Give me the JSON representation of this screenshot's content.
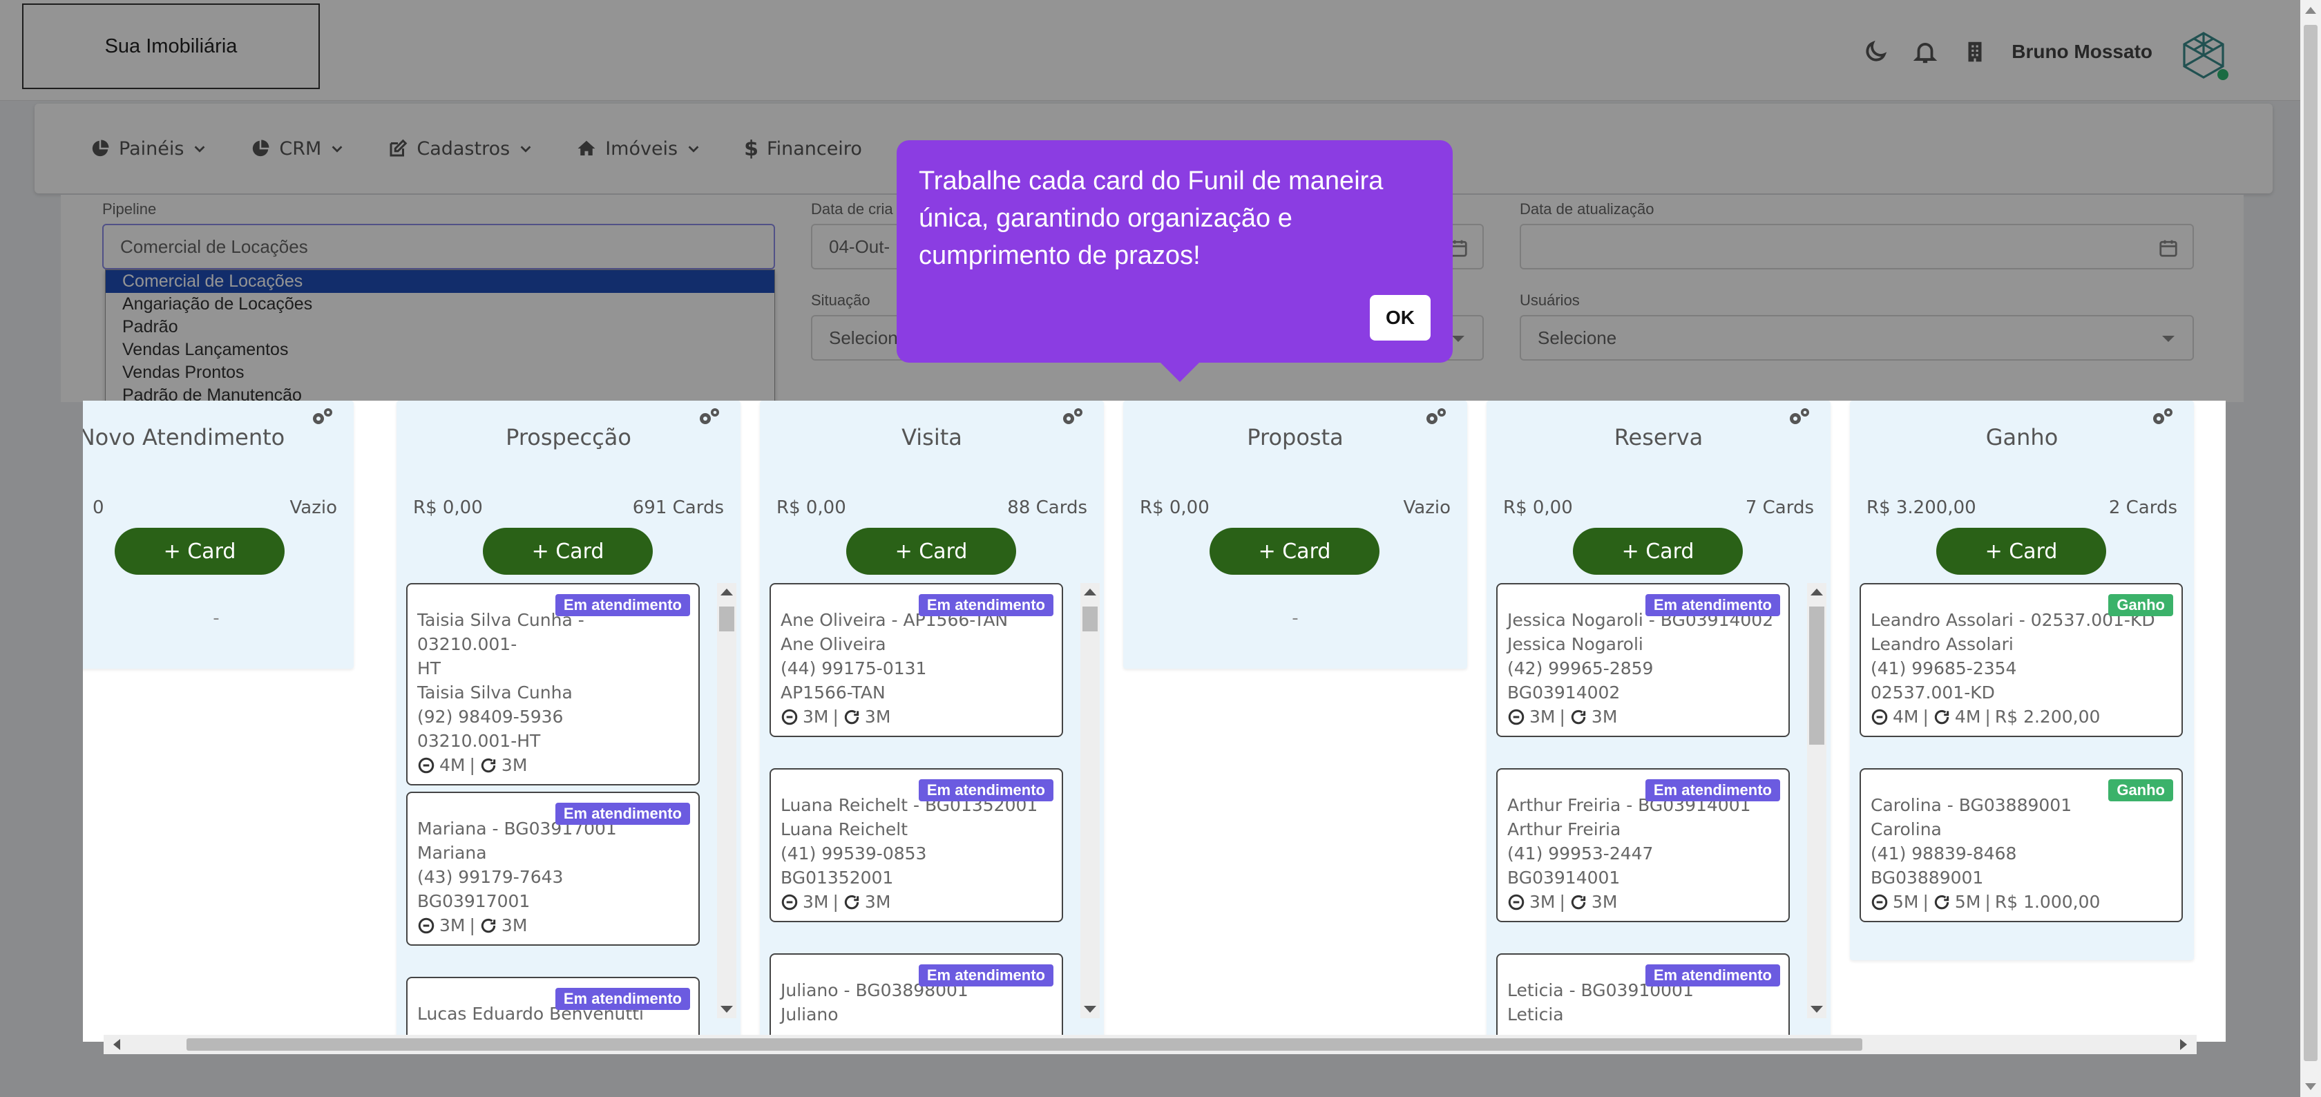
{
  "app": {
    "logo_text": "Sua Imobiliária",
    "user_name": "Bruno Mossato"
  },
  "icons": {
    "theme": "moon-icon",
    "notifications": "bell-icon",
    "company": "building-icon",
    "settings": "gears-icon"
  },
  "nav": {
    "items": [
      {
        "label": "Painéis",
        "icon": "pie-chart-icon",
        "dropdown": true
      },
      {
        "label": "CRM",
        "icon": "pie-chart-icon",
        "dropdown": true
      },
      {
        "label": "Cadastros",
        "icon": "edit-icon",
        "dropdown": true
      },
      {
        "label": "Imóveis",
        "icon": "home-icon",
        "dropdown": true
      },
      {
        "label": "Financeiro",
        "icon": "dollar-icon",
        "dropdown": false
      }
    ]
  },
  "filters": {
    "pipeline_label": "Pipeline",
    "pipeline_value": "Comercial de Locações",
    "pipeline_options": [
      "Comercial de Locações",
      "Angariação de Locações",
      "Padrão",
      "Vendas Lançamentos",
      "Vendas Prontos",
      "Padrão de Manutenção"
    ],
    "created_label": "Data de cria",
    "created_value": "04-Out-",
    "updated_label": "Data de atualização",
    "updated_value": "",
    "situation_label": "Situação",
    "situation_placeholder": "Selecione",
    "users_label": "Usuários",
    "users_placeholder": "Selecione"
  },
  "tooltip": {
    "text": "Trabalhe cada card do Funil de maneira única, garantindo organização e cumprimento de prazos!",
    "ok_label": "OK"
  },
  "board": {
    "add_label": "+ Card",
    "columns": [
      {
        "title": "Novo Atendimento",
        "money": "0",
        "count": "Vazio",
        "empty": "-",
        "cards": []
      },
      {
        "title": "Prospecção",
        "money": "R$ 0,00",
        "count": "691 Cards",
        "cards": [
          {
            "badge": "Em atendimento",
            "badge_type": "atd",
            "lines": [
              "Taisia Silva Cunha - 03210.001-",
              "HT",
              "Taisia Silva Cunha",
              "(92) 98409-5936",
              "03210.001-HT"
            ],
            "meta_a": "4M",
            "meta_b": "3M",
            "extra": ""
          },
          {
            "badge": "Em atendimento",
            "badge_type": "atd",
            "lines": [
              "Mariana - BG03917001",
              "Mariana",
              "(43) 99179-7643",
              "BG03917001"
            ],
            "meta_a": "3M",
            "meta_b": "3M",
            "extra": ""
          },
          {
            "badge": "Em atendimento",
            "badge_type": "atd",
            "lines": [
              "Lucas Eduardo Benvenutti"
            ],
            "meta_a": "",
            "meta_b": "",
            "extra": ""
          }
        ]
      },
      {
        "title": "Visita",
        "money": "R$ 0,00",
        "count": "88 Cards",
        "cards": [
          {
            "badge": "Em atendimento",
            "badge_type": "atd",
            "lines": [
              "Ane Oliveira - AP1566-TAN",
              "Ane Oliveira",
              "(44) 99175-0131",
              "AP1566-TAN"
            ],
            "meta_a": "3M",
            "meta_b": "3M",
            "extra": ""
          },
          {
            "badge": "Em atendimento",
            "badge_type": "atd",
            "lines": [
              "Luana Reichelt - BG01352001",
              "Luana Reichelt",
              "(41) 99539-0853",
              "BG01352001"
            ],
            "meta_a": "3M",
            "meta_b": "3M",
            "extra": ""
          },
          {
            "badge": "Em atendimento",
            "badge_type": "atd",
            "lines": [
              "Juliano - BG03898001",
              "Juliano"
            ],
            "meta_a": "",
            "meta_b": "",
            "extra": ""
          }
        ]
      },
      {
        "title": "Proposta",
        "money": "R$ 0,00",
        "count": "Vazio",
        "empty": "-",
        "cards": []
      },
      {
        "title": "Reserva",
        "money": "R$ 0,00",
        "count": "7 Cards",
        "cards": [
          {
            "badge": "Em atendimento",
            "badge_type": "atd",
            "lines": [
              "Jessica Nogaroli - BG03914002",
              "Jessica Nogaroli",
              "(42) 99965-2859",
              "BG03914002"
            ],
            "meta_a": "3M",
            "meta_b": "3M",
            "extra": ""
          },
          {
            "badge": "Em atendimento",
            "badge_type": "atd",
            "lines": [
              "Arthur Freiria - BG03914001",
              "Arthur Freiria",
              "(41) 99953-2447",
              "BG03914001"
            ],
            "meta_a": "3M",
            "meta_b": "3M",
            "extra": ""
          },
          {
            "badge": "Em atendimento",
            "badge_type": "atd",
            "lines": [
              "Leticia - BG03910001",
              "Leticia"
            ],
            "meta_a": "",
            "meta_b": "",
            "extra": ""
          }
        ]
      },
      {
        "title": "Ganho",
        "money": "R$ 3.200,00",
        "count": "2 Cards",
        "cards": [
          {
            "badge": "Ganho",
            "badge_type": "win",
            "lines": [
              "Leandro Assolari - 02537.001-KD",
              "Leandro Assolari",
              "(41) 99685-2354",
              "02537.001-KD"
            ],
            "meta_a": "4M",
            "meta_b": "4M",
            "extra": "R$ 2.200,00"
          },
          {
            "badge": "Ganho",
            "badge_type": "win",
            "lines": [
              "Carolina - BG03889001",
              "Carolina",
              "(41) 98839-8468",
              "BG03889001"
            ],
            "meta_a": "5M",
            "meta_b": "5M",
            "extra": "R$ 1.000,00"
          }
        ]
      }
    ]
  }
}
